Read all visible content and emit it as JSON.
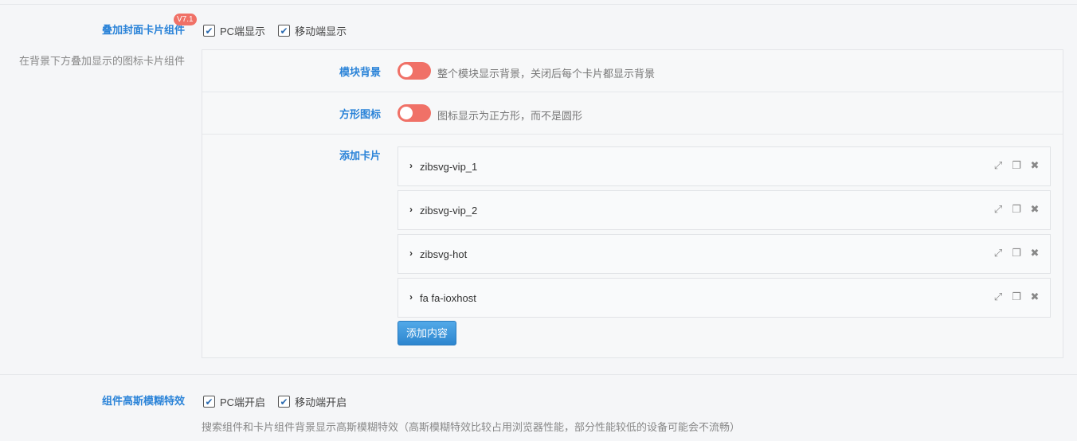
{
  "section1": {
    "title": "叠加封面卡片组件",
    "badge": "V7.1",
    "description": "在背景下方叠加显示的图标卡片组件",
    "checkboxes": [
      {
        "label": "PC端显示",
        "checked": true
      },
      {
        "label": "移动端显示",
        "checked": true
      }
    ]
  },
  "panel": {
    "module_bg": {
      "label": "模块背景",
      "hint": "整个模块显示背景，关闭后每个卡片都显示背景",
      "enabled": true
    },
    "square_icon": {
      "label": "方形图标",
      "hint": "图标显示为正方形，而不是圆形",
      "enabled": true
    },
    "cards": {
      "label": "添加卡片",
      "items": [
        {
          "title": "zibsvg-vip_1"
        },
        {
          "title": "zibsvg-vip_2"
        },
        {
          "title": "zibsvg-hot"
        },
        {
          "title": "fa fa-ioxhost"
        }
      ],
      "add_button": "添加内容"
    }
  },
  "section2": {
    "title": "组件高斯模糊特效",
    "checkboxes": [
      {
        "label": "PC端开启",
        "checked": true
      },
      {
        "label": "移动端开启",
        "checked": true
      }
    ],
    "description": "搜索组件和卡片组件背景显示高斯模糊特效（高斯模糊特效比较占用浏览器性能，部分性能较低的设备可能会不流畅）"
  },
  "colors": {
    "accent": "#2a83d8",
    "toggle_on": "#f07167",
    "badge": "#f07167"
  },
  "icons": {
    "check": "check-icon",
    "chevron": "chevron-right-icon",
    "expand": "expand-icon",
    "copy": "copy-icon",
    "remove": "close-icon"
  }
}
